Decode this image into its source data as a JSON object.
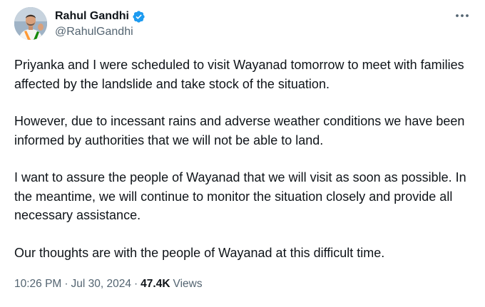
{
  "author": {
    "display_name": "Rahul Gandhi",
    "handle": "@RahulGandhi",
    "verified": true,
    "verified_color": "#1d9bf0"
  },
  "tweet": {
    "paragraphs": [
      "Priyanka and I were scheduled to visit Wayanad tomorrow to meet with families affected by the landslide and take stock of the situation.",
      "However, due to incessant rains and adverse weather conditions we have been informed by authorities that we will not be able to land.",
      "I want to assure the people of Wayanad that we will visit as soon as possible. In the meantime, we will continue to monitor the situation closely and provide all necessary assistance.",
      "Our thoughts are with the people of Wayanad at this difficult time."
    ]
  },
  "meta": {
    "time": "10:26 PM",
    "separator": "·",
    "date": "Jul 30, 2024",
    "views_count": "47.4K",
    "views_label": "Views"
  },
  "icons": {
    "more": "more-horizontal-icon",
    "verified": "verified-badge-icon"
  }
}
